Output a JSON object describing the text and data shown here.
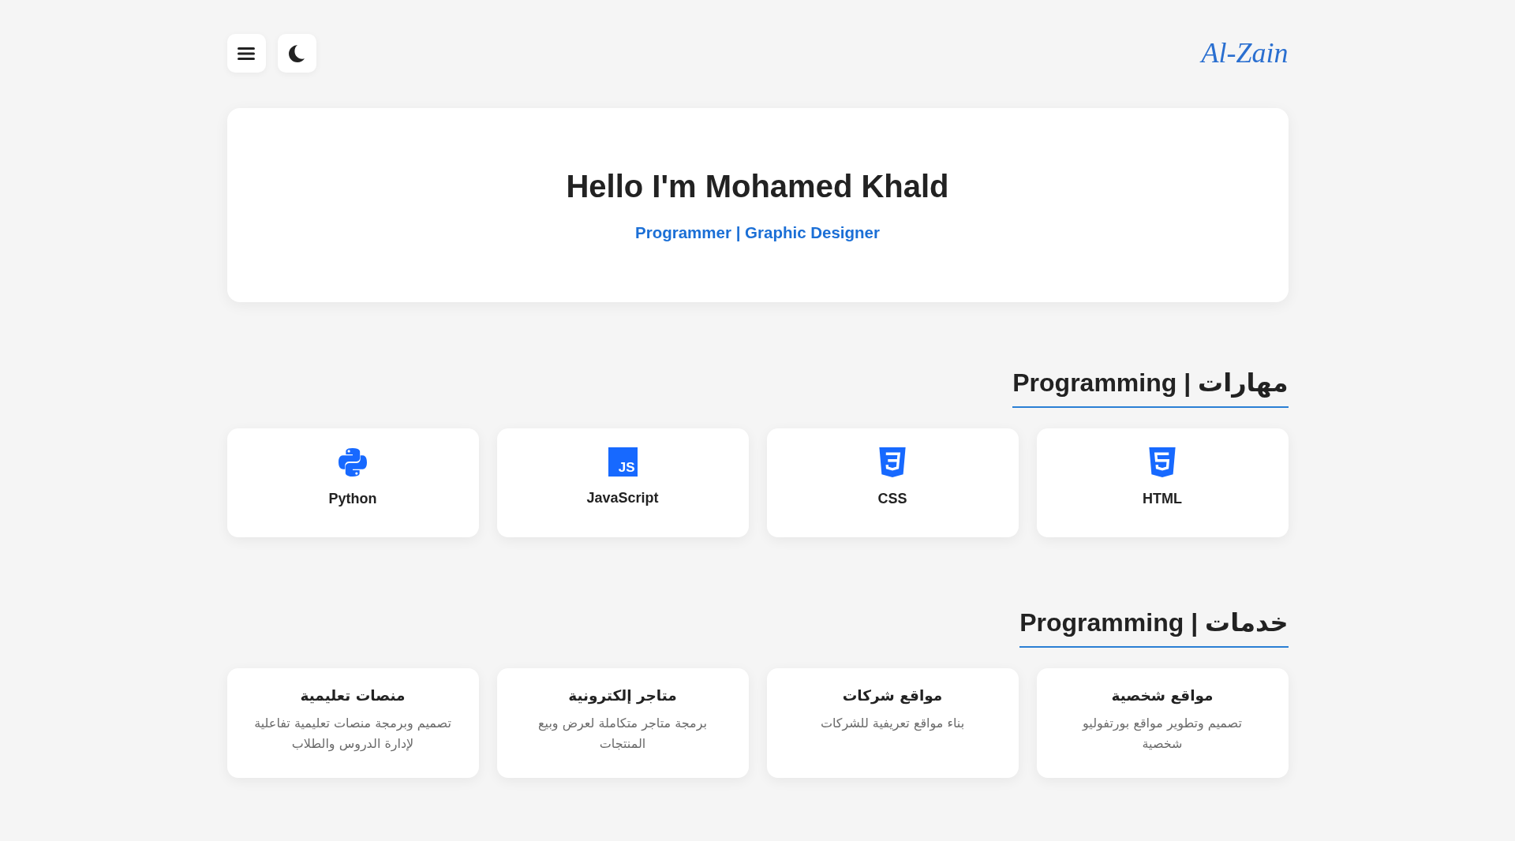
{
  "header": {
    "logo": "Al-Zain"
  },
  "hero": {
    "title": "Hello I'm Mohamed Khald",
    "subtitle": "Programmer | Graphic Designer"
  },
  "skills": {
    "heading": "مهارات | Programming",
    "items": [
      {
        "kind": "html",
        "label": "HTML"
      },
      {
        "kind": "css",
        "label": "CSS"
      },
      {
        "kind": "javascript",
        "label": "JavaScript",
        "icon_text": "JS"
      },
      {
        "kind": "python",
        "label": "Python"
      }
    ]
  },
  "services": {
    "heading": "خدمات | Programming",
    "items": [
      {
        "title": "مواقع شخصية",
        "description": "تصميم وتطوير مواقع بورتفوليو شخصية"
      },
      {
        "title": "مواقع شركات",
        "description": "بناء مواقع تعريفية للشركات"
      },
      {
        "title": "متاجر إلكترونية",
        "description": "برمجة متاجر متكاملة لعرض وبيع المنتجات"
      },
      {
        "title": "منصات تعليمية",
        "description": "تصميم وبرمجة منصات تعليمية تفاعلية لإدارة الدروس والطلاب"
      }
    ]
  }
}
